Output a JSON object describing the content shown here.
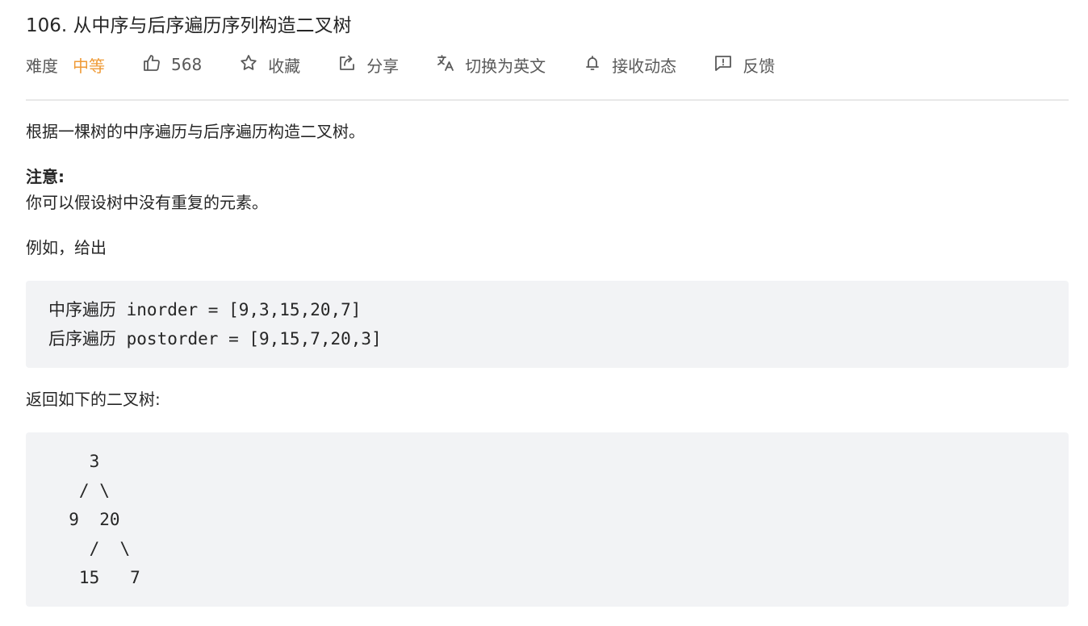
{
  "problem": {
    "title": "106. 从中序与后序遍历序列构造二叉树"
  },
  "meta": {
    "difficulty_label": "难度",
    "difficulty_value": "中等",
    "likes": "568",
    "favorite_label": "收藏",
    "share_label": "分享",
    "switch_lang_label": "切换为英文",
    "subscribe_label": "接收动态",
    "feedback_label": "反馈"
  },
  "description": {
    "intro": "根据一棵树的中序遍历与后序遍历构造二叉树。",
    "note_heading": "注意:",
    "note_text": "你可以假设树中没有重复的元素。",
    "example_intro": "例如，给出",
    "code_example_lines": [
      "中序遍历 inorder = [9,3,15,20,7]",
      "后序遍历 postorder = [9,15,7,20,3]"
    ],
    "result_intro": "返回如下的二叉树:",
    "tree_lines": [
      "    3",
      "   / \\",
      "  9  20",
      "    /  \\",
      "   15   7"
    ]
  },
  "colors": {
    "difficulty_medium": "#ef9a36",
    "code_background": "#f2f3f5",
    "divider": "#e8e8e8",
    "text_primary": "#262626",
    "text_secondary": "#595959"
  },
  "icons": {
    "likes": "thumbs-up-icon",
    "favorite": "star-icon",
    "share": "share-icon",
    "switch_lang": "translate-icon",
    "subscribe": "bell-icon",
    "feedback": "feedback-icon"
  }
}
